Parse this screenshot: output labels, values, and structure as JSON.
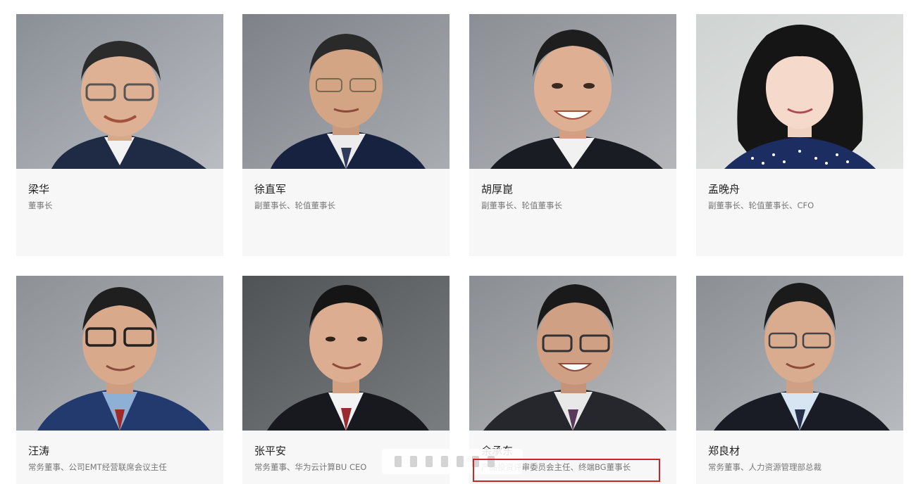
{
  "people": [
    {
      "name": "梁华",
      "title": "董事长"
    },
    {
      "name": "徐直军",
      "title": "副董事长、轮值董事长"
    },
    {
      "name": "胡厚崑",
      "title": "副董事长、轮值董事长"
    },
    {
      "name": "孟晚舟",
      "title": "副董事长、轮值董事长、CFO"
    },
    {
      "name": "汪涛",
      "title": "常务董事、公司EMT经营联席会议主任"
    },
    {
      "name": "张平安",
      "title": "常务董事、华为云计算BU CEO"
    },
    {
      "name": "余承东",
      "title": "产品投资评审委员会主任、终端BG董事长"
    },
    {
      "name": "郑良材",
      "title": "常务董事、人力资源管理部总裁"
    }
  ],
  "colors": {
    "card_bg": "#f7f7f7",
    "highlight": "#c62828",
    "name": "#222222",
    "title": "#777777"
  }
}
